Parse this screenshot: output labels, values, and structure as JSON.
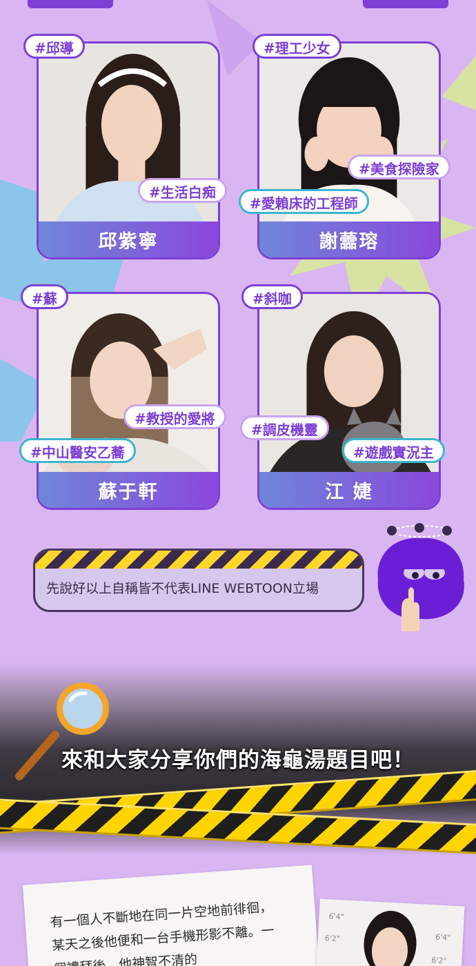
{
  "profiles": [
    {
      "name": "邱紫寧",
      "tags": [
        "#邱導",
        "#生活白痴"
      ]
    },
    {
      "name": "謝蘦瑢",
      "tags": [
        "#理工少女",
        "#美食探險家",
        "#愛賴床的工程師"
      ]
    },
    {
      "name": "蘇于軒",
      "tags": [
        "#蘇",
        "#教授的愛將",
        "#中山醫安乙蕎"
      ]
    },
    {
      "name": "江 婕",
      "tags": [
        "#斜咖",
        "#調皮機靈",
        "#遊戲實況主"
      ]
    }
  ],
  "disclaimer": "先說好以上自稱皆不代表LINE WEBTOON立場",
  "headline": "來和大家分享你們的海龜湯題目吧！",
  "note": "有一個人不斷地在同一片空地前徘徊，某天之後他便和一台手機形影不離。一個禮拜後，他神智不清的",
  "mugshot_marks": [
    "6'4\"",
    "6'2\"",
    "6'4\"",
    "6'2\""
  ],
  "colors": {
    "purple": "#7c3fd6",
    "teal": "#3bb5d0",
    "background": "#d9b6f2"
  }
}
